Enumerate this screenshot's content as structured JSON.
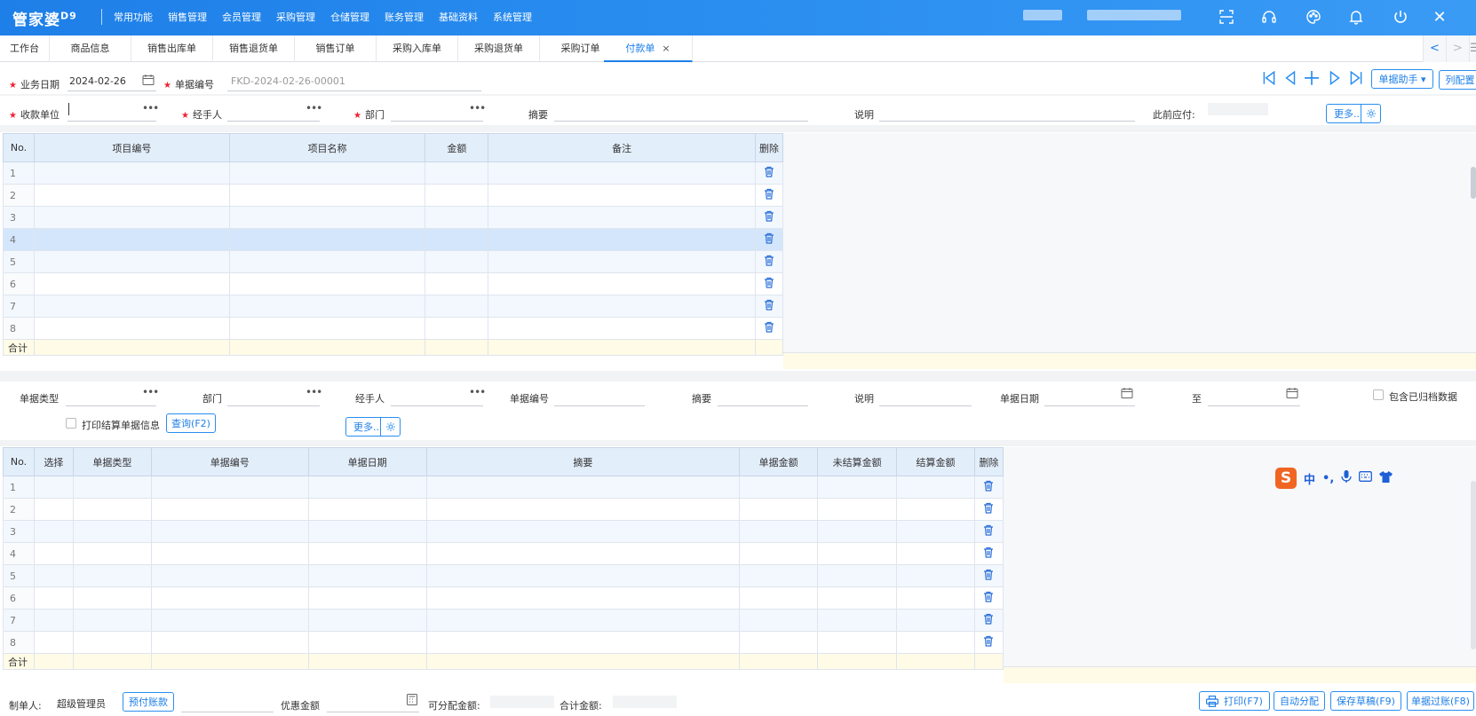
{
  "app": {
    "logo": "管家婆",
    "logo_version": "D9",
    "menu": [
      "常用功能",
      "销售管理",
      "会员管理",
      "采购管理",
      "仓储管理",
      "账务管理",
      "基础资料",
      "系统管理"
    ]
  },
  "tabs": [
    {
      "label": "工作台"
    },
    {
      "label": "商品信息"
    },
    {
      "label": "销售出库单"
    },
    {
      "label": "销售退货单"
    },
    {
      "label": "销售订单"
    },
    {
      "label": "采购入库单"
    },
    {
      "label": "采购退货单"
    },
    {
      "label": "采购订单"
    },
    {
      "label": "付款单",
      "close": "×"
    }
  ],
  "tab_nav": {
    "prev": "<",
    "next": ">",
    "list": "☰"
  },
  "header": {
    "date_label": "业务日期",
    "date_value": "2024-02-26",
    "billno_label": "单据编号",
    "billno_value": "FKD-2024-02-26-00001",
    "assistant_button": "单据助手 ▾",
    "column_config_button": "列配置",
    "payee_label": "收款单位",
    "handler_label": "经手人",
    "dept_label": "部门",
    "summary_label": "摘要",
    "remark_label": "说明",
    "prev_payable_label": "此前应付:",
    "more_button": "更多.."
  },
  "grid1": {
    "columns": [
      "No.",
      "项目编号",
      "项目名称",
      "金额",
      "备注",
      "删除"
    ],
    "rows": [
      "1",
      "2",
      "3",
      "4",
      "5",
      "6",
      "7",
      "8"
    ],
    "selected_row": 4,
    "sum_label": "合计"
  },
  "filter": {
    "bill_type_label": "单据类型",
    "dept_label": "部门",
    "handler_label": "经手人",
    "billno_label": "单据编号",
    "summary_label": "摘要",
    "remark_label": "说明",
    "bill_date_label": "单据日期",
    "to_label": "至",
    "include_archived_label": "包含已归档数据",
    "print_settle_label": "打印结算单据信息",
    "query_button": "查询(F2)",
    "more_button": "更多.."
  },
  "grid2": {
    "columns": [
      "No.",
      "选择",
      "单据类型",
      "单据编号",
      "单据日期",
      "摘要",
      "单据金额",
      "未结算金额",
      "结算金额",
      "删除"
    ],
    "rows": [
      "1",
      "2",
      "3",
      "4",
      "5",
      "6",
      "7",
      "8"
    ],
    "sum_label": "合计"
  },
  "ime": {
    "logo": "S",
    "lang": "中",
    "punct": "•,"
  },
  "footer": {
    "creator_label": "制单人:",
    "creator_value": "超级管理员",
    "prepay_button": "预付账款",
    "discount_label": "优惠金额",
    "allocatable_label": "可分配金额:",
    "total_label": "合计金额:",
    "print_button": "打印(F7)",
    "auto_allocate_button": "自动分配",
    "save_draft_button": "保存草稿(F9)",
    "post_button": "单据过账(F8)"
  }
}
